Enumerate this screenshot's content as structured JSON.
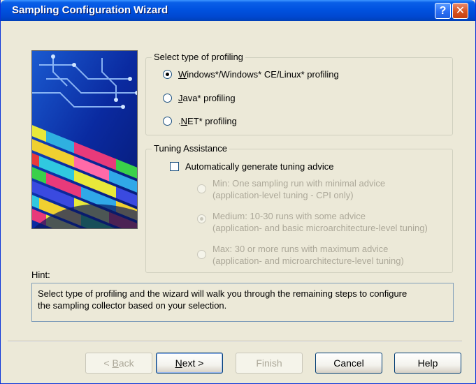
{
  "window": {
    "title": "Sampling Configuration Wizard",
    "help_glyph": "?",
    "close_glyph": "✕"
  },
  "profiling": {
    "label": "Select type of profiling",
    "options": [
      {
        "prefix": "",
        "accel": "W",
        "rest": "indows*/Windows* CE/Linux* profiling",
        "selected": true
      },
      {
        "prefix": "",
        "accel": "J",
        "rest": "ava* profiling",
        "selected": false
      },
      {
        "prefix": ".",
        "accel": "N",
        "rest": "ET* profiling",
        "selected": false
      }
    ]
  },
  "tuning": {
    "label": "Tuning Assistance",
    "checkbox_label": "Automatically generate tuning advice",
    "checked": false,
    "levels": [
      {
        "line1": "Min: One sampling run with minimal advice",
        "line2": "(application-level tuning - CPI only)",
        "selected": false
      },
      {
        "line1": "Medium: 10-30 runs with some advice",
        "line2": "(application- and basic microarchitecture-level tuning)",
        "selected": true
      },
      {
        "line1": "Max: 30 or more runs with maximum advice",
        "line2": "(application- and microarchitecture-level tuning)",
        "selected": false
      }
    ]
  },
  "hint": {
    "label": "Hint:",
    "line1": "Select type of profiling and the wizard will walk you through the remaining steps to configure",
    "line2": "the sampling collector based on your selection."
  },
  "buttons": {
    "back": {
      "accel": "B",
      "pre": "< ",
      "rest": "ack"
    },
    "next": {
      "accel": "N",
      "rest": "ext >"
    },
    "finish": "Finish",
    "cancel": "Cancel",
    "help": "Help"
  },
  "colors": {
    "titlebar": "#0052e0",
    "dialog_bg": "#ece9d8",
    "disabled_text": "#aca899"
  }
}
